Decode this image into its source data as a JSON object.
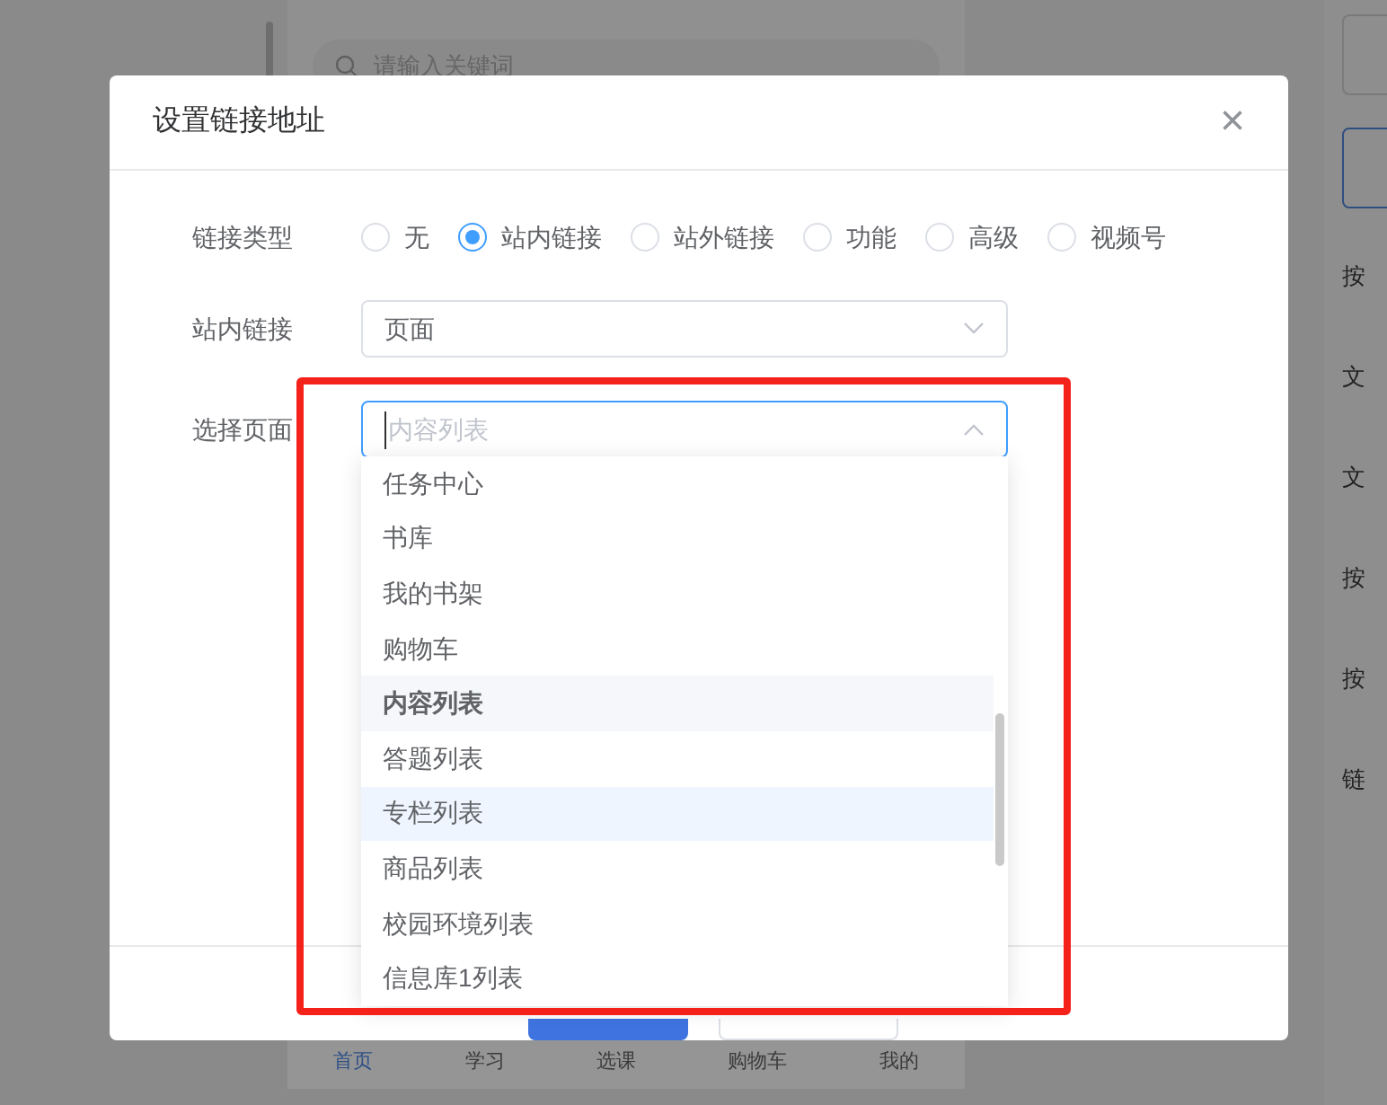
{
  "background": {
    "search": {
      "placeholder": "请输入关键词"
    },
    "tab_bar": [
      {
        "label": "首页",
        "selected": true
      },
      {
        "label": "学习",
        "selected": false
      },
      {
        "label": "选课",
        "selected": false
      },
      {
        "label": "购物车",
        "selected": false
      },
      {
        "label": "我的",
        "selected": false
      }
    ],
    "right_panel_labels": [
      "按",
      "文",
      "文",
      "按",
      "按",
      "链"
    ]
  },
  "dialog": {
    "title": "设置链接地址",
    "close": "×",
    "link_type": {
      "label": "链接类型",
      "options": [
        {
          "label": "无",
          "selected": false
        },
        {
          "label": "站内链接",
          "selected": true
        },
        {
          "label": "站外链接",
          "selected": false
        },
        {
          "label": "功能",
          "selected": false
        },
        {
          "label": "高级",
          "selected": false
        },
        {
          "label": "视频号",
          "selected": false
        }
      ]
    },
    "internal_link": {
      "label": "站内链接",
      "value": "页面"
    },
    "page_select": {
      "label": "选择页面",
      "placeholder": "内容列表",
      "expanded": true,
      "options": [
        {
          "label": "任务中心",
          "selected": false,
          "hovered": false
        },
        {
          "label": "书库",
          "selected": false,
          "hovered": false
        },
        {
          "label": "我的书架",
          "selected": false,
          "hovered": false
        },
        {
          "label": "购物车",
          "selected": false,
          "hovered": false
        },
        {
          "label": "内容列表",
          "selected": true,
          "hovered": false
        },
        {
          "label": "答题列表",
          "selected": false,
          "hovered": false
        },
        {
          "label": "专栏列表",
          "selected": false,
          "hovered": true
        },
        {
          "label": "商品列表",
          "selected": false,
          "hovered": false
        },
        {
          "label": "校园环境列表",
          "selected": false,
          "hovered": false
        },
        {
          "label": "信息库1列表",
          "selected": false,
          "hovered": false
        }
      ]
    }
  }
}
